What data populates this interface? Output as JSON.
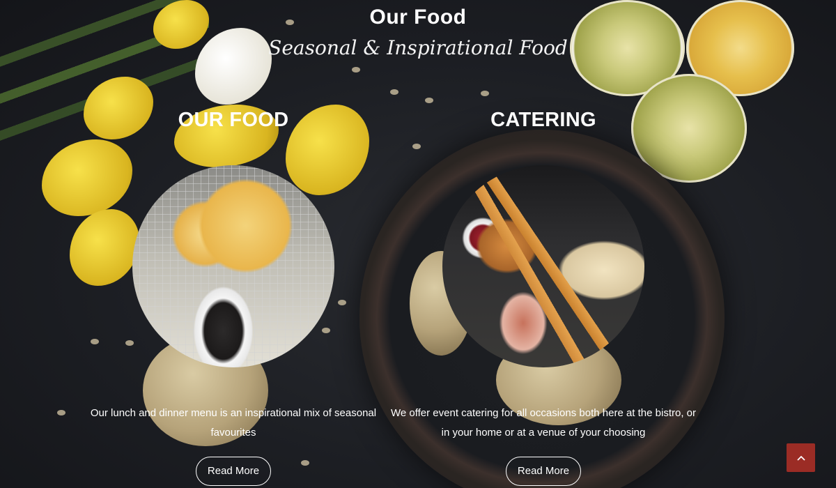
{
  "header": {
    "title": "Our Food",
    "subtitle": "Seasonal & Inspirational Food"
  },
  "sections": [
    {
      "heading": "OUR FOOD",
      "image": "fried-food-basket-with-dip",
      "text": "Our lunch and dinner menu is an inspirational mix of seasonal favourites",
      "button_label": "Read More"
    },
    {
      "heading": "CATERING",
      "image": "breadsticks-bread-and-ham-platter",
      "text": "We offer event catering for all occasions both here at the bistro, or in your home or at a venue of your choosing",
      "button_label": "Read More"
    }
  ],
  "back_to_top": {
    "icon": "chevron-up-icon",
    "color": "#9b2c25"
  },
  "colors": {
    "background": "#1b1d22",
    "text": "#ffffff"
  }
}
